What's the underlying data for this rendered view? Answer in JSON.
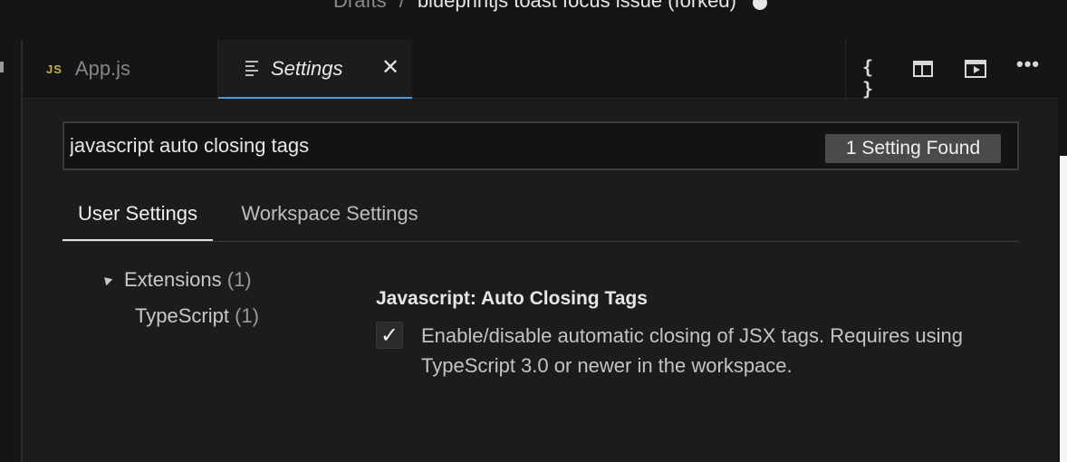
{
  "titlebar": {
    "breadcrumb_root": "Drafts",
    "separator": "/",
    "sandbox_name": "blueprintjs toast focus issue (forked)"
  },
  "tabs": {
    "app": {
      "badge": "JS",
      "label": "App.js"
    },
    "settings": {
      "label": "Settings",
      "close": "✕"
    }
  },
  "actions": {
    "braces": "{ }",
    "more": "•••",
    "icons": [
      "braces-icon",
      "split-editor-icon",
      "preview-icon",
      "more-icon"
    ]
  },
  "search": {
    "value": "javascript auto closing tags",
    "found": "1 Setting Found"
  },
  "scope_tabs": {
    "user": "User Settings",
    "workspace": "Workspace Settings"
  },
  "tree": {
    "extensions": {
      "label": "Extensions",
      "count": "(1)"
    },
    "typescript": {
      "label": "TypeScript",
      "count": "(1)"
    }
  },
  "setting": {
    "category": "Javascript:",
    "name": "Auto Closing Tags",
    "checked_glyph": "✓",
    "description": "Enable/disable automatic closing of JSX tags. Requires using TypeScript 3.0 or newer in the workspace."
  },
  "colors": {
    "accent": "#4a9ad6",
    "js_badge": "#c6b13e",
    "background": "#1c1c1c"
  }
}
